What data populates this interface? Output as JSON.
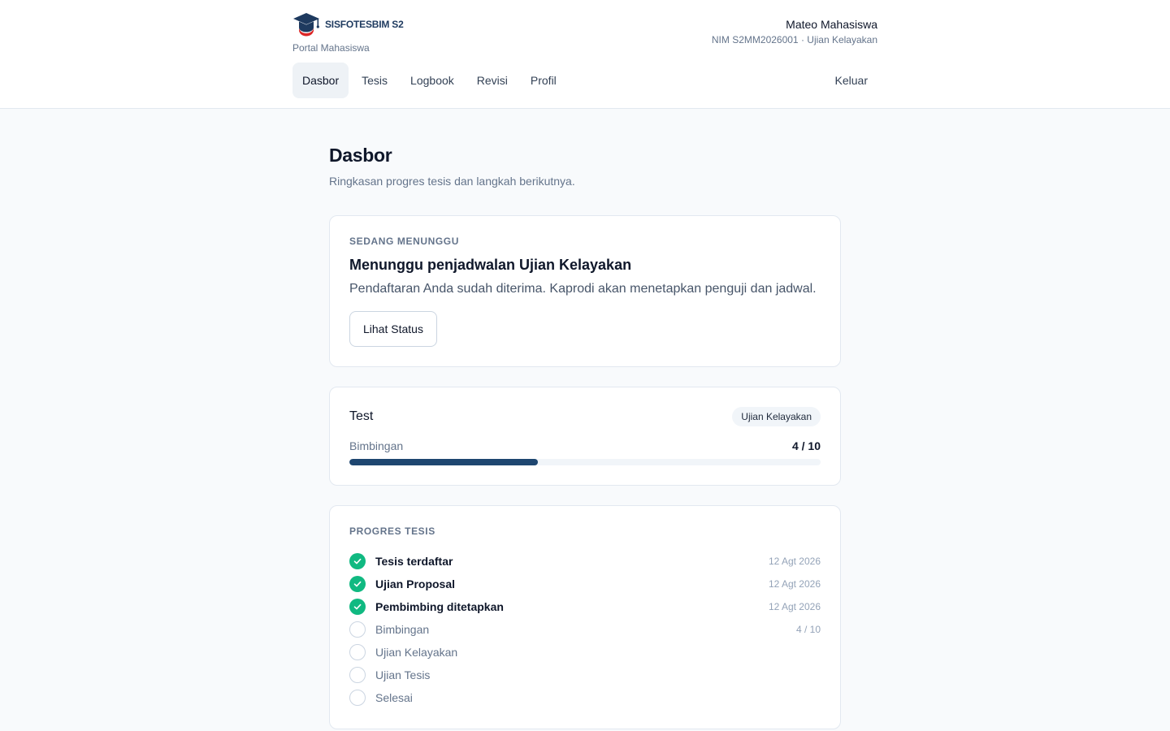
{
  "app": {
    "brand_name": "SISFOTESBIM S2",
    "brand_sub": "Portal Mahasiswa"
  },
  "user": {
    "name": "Mateo Mahasiswa",
    "meta": "NIM S2MM2026001 · Ujian Kelayakan"
  },
  "nav": {
    "items": [
      {
        "label": "Dasbor",
        "active": true
      },
      {
        "label": "Tesis",
        "active": false
      },
      {
        "label": "Logbook",
        "active": false
      },
      {
        "label": "Revisi",
        "active": false
      },
      {
        "label": "Profil",
        "active": false
      }
    ],
    "logout_label": "Keluar"
  },
  "page": {
    "title": "Dasbor",
    "subtitle": "Ringkasan progres tesis dan langkah berikutnya."
  },
  "status_card": {
    "eyebrow": "SEDANG MENUNGGU",
    "title": "Menunggu penjadwalan Ujian Kelayakan",
    "description": "Pendaftaran Anda sudah diterima. Kaprodi akan menetapkan penguji dan jadwal.",
    "button_label": "Lihat Status"
  },
  "thesis_card": {
    "title": "Test",
    "badge": "Ujian Kelayakan",
    "progress_label": "Bimbingan",
    "progress_count": "4 / 10",
    "progress_fraction": 0.4
  },
  "progress_card": {
    "eyebrow": "PROGRES TESIS",
    "steps": [
      {
        "label": "Tesis terdaftar",
        "meta": "12 Agt 2026",
        "done": true
      },
      {
        "label": "Ujian Proposal",
        "meta": "12 Agt 2026",
        "done": true
      },
      {
        "label": "Pembimbing ditetapkan",
        "meta": "12 Agt 2026",
        "done": true
      },
      {
        "label": "Bimbingan",
        "meta": "4 / 10",
        "done": false
      },
      {
        "label": "Ujian Kelayakan",
        "meta": "",
        "done": false
      },
      {
        "label": "Ujian Tesis",
        "meta": "",
        "done": false
      },
      {
        "label": "Selesai",
        "meta": "",
        "done": false
      }
    ]
  },
  "colors": {
    "accent": "#1e4670",
    "success": "#10b981"
  }
}
